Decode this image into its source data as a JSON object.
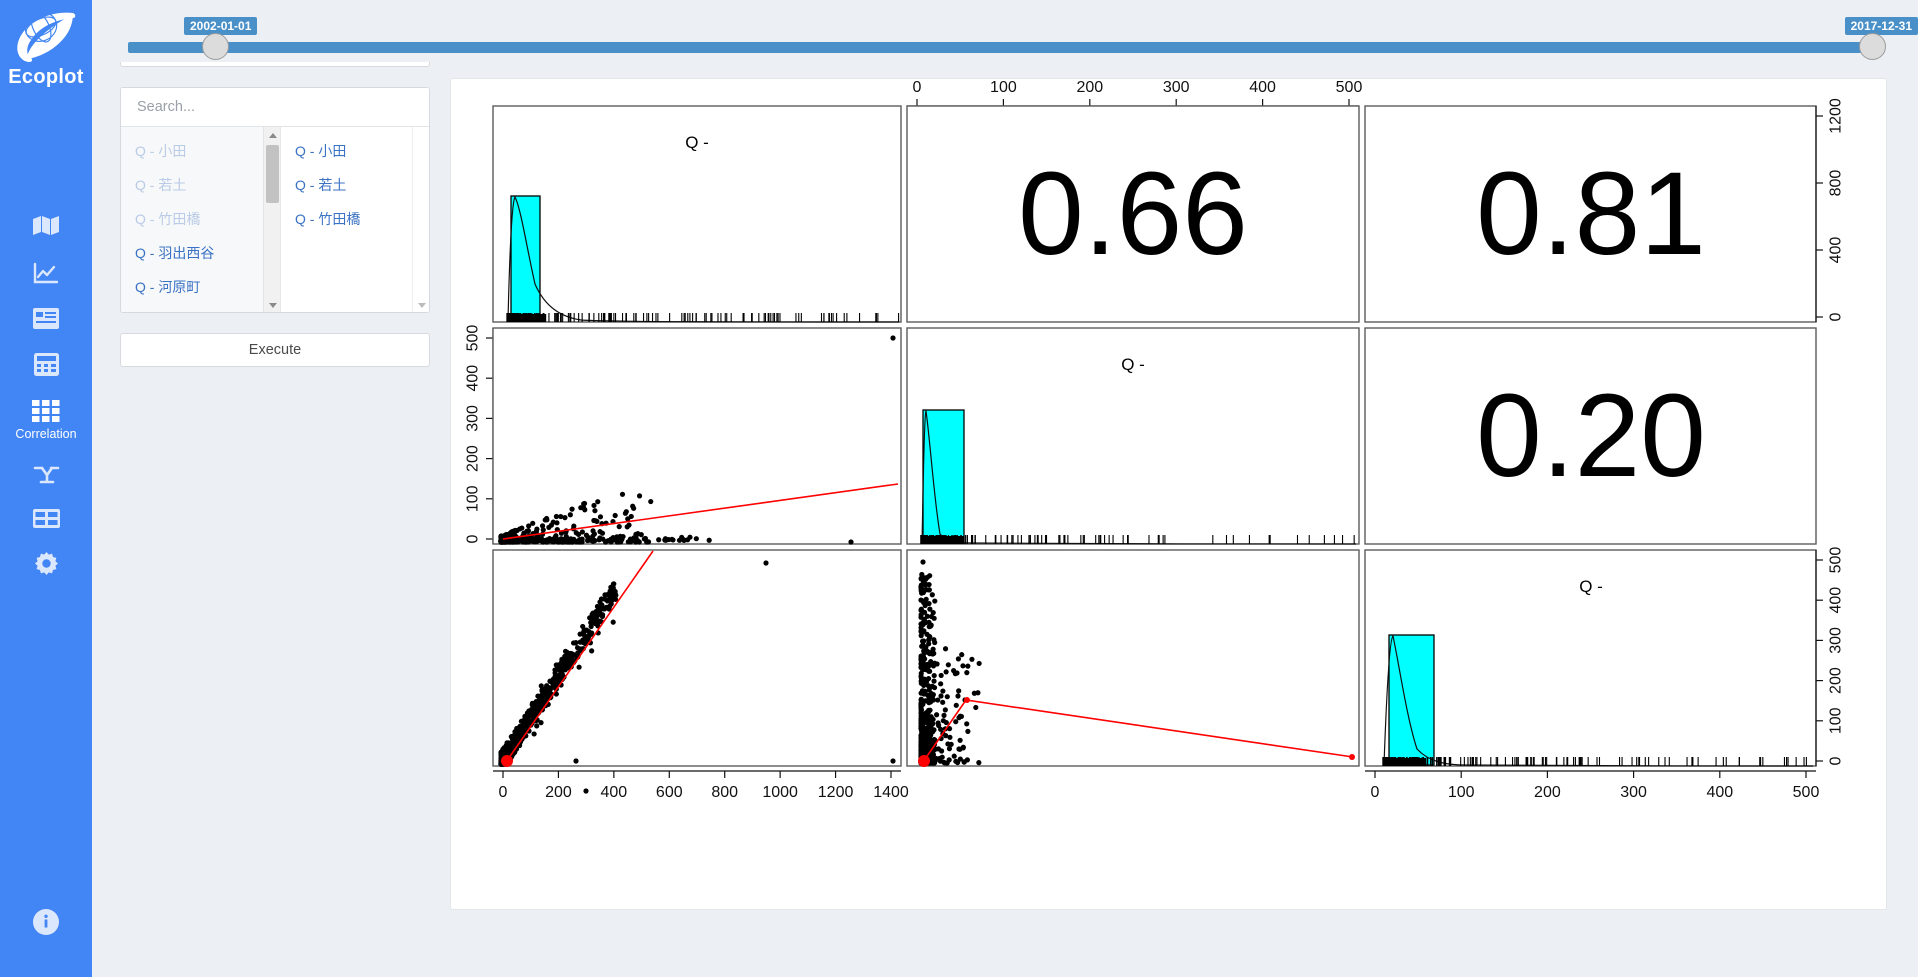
{
  "app": {
    "brand": "Ecoplot",
    "logo_icon": "leaf-globe-logo"
  },
  "sidebar": {
    "items": [
      {
        "label": "",
        "icon": "map-icon",
        "name": "map",
        "active": false
      },
      {
        "label": "",
        "icon": "line-chart-icon",
        "name": "timeseries",
        "active": false
      },
      {
        "label": "",
        "icon": "report-icon",
        "name": "report",
        "active": false
      },
      {
        "label": "",
        "icon": "calculator-icon",
        "name": "statistics",
        "active": false
      },
      {
        "label": "Correlation",
        "icon": "grid-icon",
        "name": "correlation",
        "active": true
      },
      {
        "label": "",
        "icon": "network-icon",
        "name": "network",
        "active": false
      },
      {
        "label": "",
        "icon": "table-icon",
        "name": "table",
        "active": false
      },
      {
        "label": "",
        "icon": "gear-icon",
        "name": "settings",
        "active": false
      }
    ],
    "bottom_item": {
      "label": "",
      "icon": "info-icon",
      "name": "info"
    }
  },
  "slider": {
    "start_label": "2002-01-01",
    "end_label": "2017-12-31",
    "track_color": "#4a90c8"
  },
  "controls": {
    "date_range_value": "2002-01-01 - 2017-12-31",
    "search_placeholder": "Search...",
    "search_value": "",
    "available_items": [
      {
        "prefix": "Q",
        "sep": "-",
        "name": "小田",
        "selected": true
      },
      {
        "prefix": "Q",
        "sep": "-",
        "name": "若土",
        "selected": true
      },
      {
        "prefix": "Q",
        "sep": "-",
        "name": "竹田橋",
        "selected": true
      },
      {
        "prefix": "Q",
        "sep": "-",
        "name": "羽出西谷",
        "selected": false
      },
      {
        "prefix": "Q",
        "sep": "-",
        "name": "河原町",
        "selected": false
      }
    ],
    "chosen_items": [
      {
        "prefix": "Q",
        "sep": "-",
        "name": "小田"
      },
      {
        "prefix": "Q",
        "sep": "-",
        "name": "若土"
      },
      {
        "prefix": "Q",
        "sep": "-",
        "name": "竹田橋"
      }
    ],
    "execute_label": "Execute"
  },
  "chart_data": {
    "type": "scatter",
    "title": "",
    "description": "Correlation scatter-plot matrix (pairs plot) of three discharge variables",
    "variables": [
      "Q -",
      "Q -",
      "Q -"
    ],
    "diagonal": "histogram with density curve and rug",
    "upper_triangle": "pearson correlation coefficient",
    "lower_triangle": "scatter with red least-squares/lowess line",
    "correlations": [
      {
        "row": 1,
        "col": 2,
        "value": "0.66"
      },
      {
        "row": 1,
        "col": 3,
        "value": "0.81"
      },
      {
        "row": 2,
        "col": 3,
        "value": "0.20"
      }
    ],
    "axes": {
      "top": {
        "ticks": [
          0,
          100,
          200,
          300,
          400,
          500
        ],
        "for_column": 2
      },
      "bottom_left": {
        "ticks": [
          0,
          200,
          400,
          600,
          800,
          1000,
          1200,
          1400
        ],
        "for_column": 1
      },
      "bottom_right": {
        "ticks": [
          0,
          100,
          200,
          300,
          400,
          500
        ],
        "for_column": 3
      },
      "left_row2": {
        "ticks": [
          0,
          100,
          200,
          300,
          400,
          500
        ]
      },
      "right_row1": {
        "ticks": [
          0,
          400,
          800,
          1200
        ]
      },
      "right_row3": {
        "ticks": [
          0,
          100,
          200,
          300,
          400,
          500
        ]
      }
    },
    "colors": {
      "histogram_fill": "#00ffff",
      "fit_line": "#ff0000",
      "point": "#000000"
    }
  }
}
